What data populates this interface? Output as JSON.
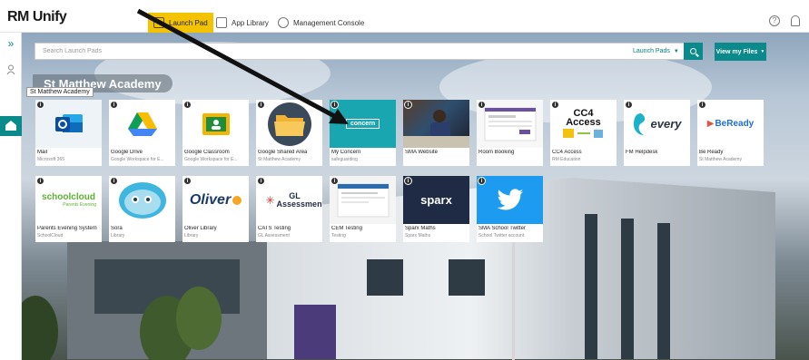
{
  "brand": {
    "logo": "RM Unify"
  },
  "nav": {
    "tabs": [
      {
        "label": "Launch Pad",
        "icon": "rocket-icon",
        "active": true
      },
      {
        "label": "App Library",
        "icon": "grid-icon",
        "active": false
      },
      {
        "label": "Management Console",
        "icon": "gear-icon",
        "active": false
      }
    ]
  },
  "rail": {
    "expand": "»"
  },
  "search": {
    "placeholder": "Search Launch Pads",
    "scope_value": "Launch Pads",
    "files_button": "View my Files"
  },
  "section": {
    "title": "St Matthew Academy",
    "tooltip": "St Matthew Academy"
  },
  "tiles": [
    {
      "title": "Mail",
      "subtitle": "Microsoft 365",
      "art": "outlook-logo"
    },
    {
      "title": "Google Drive",
      "subtitle": "Google Workspace for E...",
      "art": "google-drive-logo"
    },
    {
      "title": "Google Classroom",
      "subtitle": "Google Workspace for E...",
      "art": "google-classroom-logo"
    },
    {
      "title": "Google Shared Area",
      "subtitle": "St Matthew Academy",
      "art": "folder-icon"
    },
    {
      "title": "My Concern",
      "subtitle": "safeguarding",
      "art": "myconcern-logo",
      "art_text": "concern"
    },
    {
      "title": "SMA Website",
      "subtitle": "",
      "art": "classroom-photo"
    },
    {
      "title": "Room Booking",
      "subtitle": "",
      "art": "booking-screenshot"
    },
    {
      "title": "CC4 Access",
      "subtitle": "RM Education",
      "art": "cc4-logo",
      "art_text": "CC4 Access"
    },
    {
      "title": "FM Helpdesk",
      "subtitle": "",
      "art": "every-logo",
      "art_text": "every"
    },
    {
      "title": "Be Ready",
      "subtitle": "St Matthew Academy",
      "art": "beready-logo",
      "art_text": "BeReady"
    },
    {
      "title": "Parents Evening System",
      "subtitle": "SchoolCloud",
      "art": "schoolcloud-logo",
      "art_text": "schoolcloud",
      "art_sub": "Parents Evening"
    },
    {
      "title": "Sora",
      "subtitle": "Library",
      "art": "sora-logo"
    },
    {
      "title": "Oliver Library",
      "subtitle": "Library",
      "art": "oliver-logo",
      "art_text": "Oliver"
    },
    {
      "title": "CATS Testing",
      "subtitle": "GL Assessment",
      "art": "gl-logo",
      "art_text": "GL Assessment"
    },
    {
      "title": "CEM Testing",
      "subtitle": "Testing",
      "art": "cem-screenshot"
    },
    {
      "title": "Sparx Maths",
      "subtitle": "Sparx Maths",
      "art": "sparx-logo",
      "art_text": "sparx"
    },
    {
      "title": "SMA School Twitter",
      "subtitle": "School Twitter account",
      "art": "twitter-logo"
    }
  ],
  "colors": {
    "accent": "#0a8a8a",
    "nav_active": "#f3c300",
    "outlook_blue": "#0f6cbd",
    "myconcern_teal": "#1aa6b0",
    "cc4_green": "#8dc63f",
    "every_teal": "#1ab2c9",
    "beready_blue": "#1f6fd1",
    "schoolcloud_green": "#5bb131",
    "sparx_navy": "#1f2a44",
    "twitter_blue": "#1d9bf0"
  }
}
